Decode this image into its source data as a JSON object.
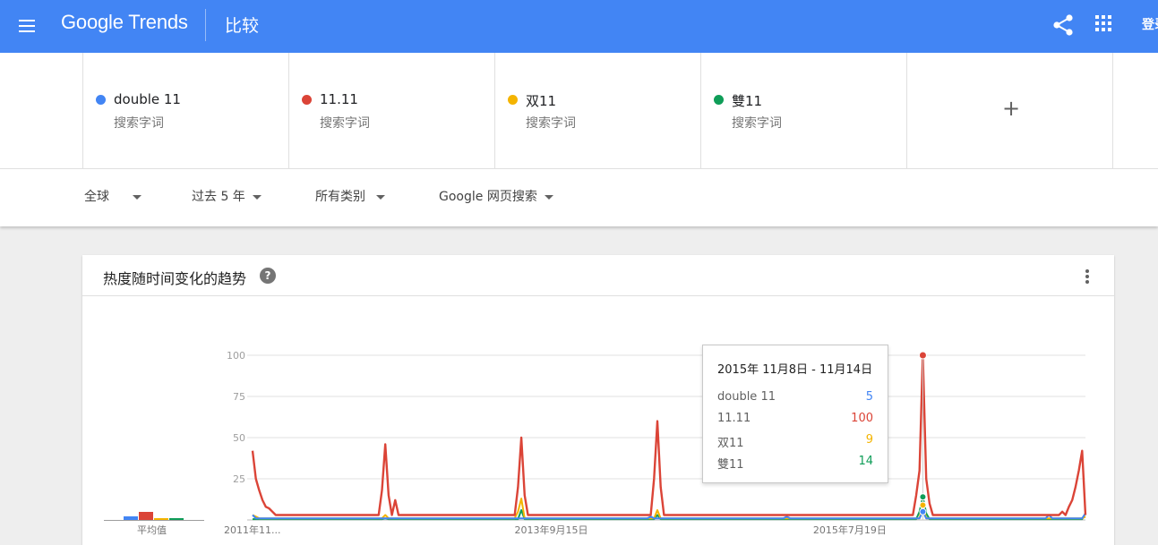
{
  "header": {
    "logo": "Google Trends",
    "title": "比较",
    "login": "登录"
  },
  "terms": [
    {
      "name": "double 11",
      "type": "搜索字词",
      "color": "#4285f4"
    },
    {
      "name": "11.11",
      "type": "搜索字词",
      "color": "#db4437"
    },
    {
      "name": "双11",
      "type": "搜索字词",
      "color": "#f4b400"
    },
    {
      "name": "雙11",
      "type": "搜索字词",
      "color": "#0f9d58"
    }
  ],
  "add_term": "+",
  "filters": {
    "region": "全球",
    "time": "过去 5 年",
    "category": "所有类别",
    "property": "Google 网页搜索"
  },
  "card": {
    "title": "热度随时间变化的趋势",
    "help": "?",
    "avg_label": "平均值"
  },
  "tooltip": {
    "date": "2015年 11月8日 - 11月14日",
    "rows": [
      {
        "label": "double 11",
        "value": "5",
        "color": "#4285f4"
      },
      {
        "label": "11.11",
        "value": "100",
        "color": "#db4437"
      },
      {
        "label": "双11",
        "value": "9",
        "color": "#f4b400"
      },
      {
        "label": "雙11",
        "value": "14",
        "color": "#0f9d58"
      }
    ]
  },
  "chart_data": {
    "type": "line",
    "y_ticks": [
      "100",
      "75",
      "50",
      "25"
    ],
    "ylim": [
      0,
      100
    ],
    "x_ticks": [
      "2011年11...",
      "2013年9月15日",
      "2015年7月19日"
    ],
    "grid": true,
    "averages": [
      {
        "name": "double 11",
        "value": 2
      },
      {
        "name": "11.11",
        "value": 5
      },
      {
        "name": "双11",
        "value": 1
      },
      {
        "name": "雙11",
        "value": 1
      }
    ],
    "highlight_index": 202,
    "series": [
      {
        "name": "double 11",
        "color": "#4285f4",
        "baseline": 1,
        "peaks": [
          [
            0,
            3
          ],
          [
            40,
            1
          ],
          [
            80,
            1
          ],
          [
            120,
            2
          ],
          [
            161,
            2
          ],
          [
            202,
            5
          ],
          [
            240,
            3
          ],
          [
            251,
            4
          ]
        ]
      },
      {
        "name": "11.11",
        "color": "#db4437",
        "baseline": 3,
        "peaks": [
          [
            0,
            42
          ],
          [
            1,
            25
          ],
          [
            2,
            18
          ],
          [
            3,
            12
          ],
          [
            4,
            8
          ],
          [
            5,
            7
          ],
          [
            6,
            5
          ],
          [
            39,
            18
          ],
          [
            40,
            46
          ],
          [
            41,
            15
          ],
          [
            43,
            12
          ],
          [
            80,
            20
          ],
          [
            81,
            50
          ],
          [
            82,
            15
          ],
          [
            121,
            25
          ],
          [
            122,
            60
          ],
          [
            123,
            20
          ],
          [
            200,
            15
          ],
          [
            201,
            30
          ],
          [
            202,
            100
          ],
          [
            203,
            25
          ],
          [
            204,
            10
          ],
          [
            244,
            5
          ],
          [
            246,
            8
          ],
          [
            247,
            12
          ],
          [
            248,
            20
          ],
          [
            249,
            30
          ],
          [
            250,
            42
          ]
        ]
      },
      {
        "name": "双11",
        "color": "#f4b400",
        "baseline": 1,
        "peaks": [
          [
            0,
            3
          ],
          [
            1,
            2
          ],
          [
            40,
            3
          ],
          [
            81,
            13
          ],
          [
            80,
            5
          ],
          [
            122,
            6
          ],
          [
            202,
            9
          ],
          [
            251,
            2
          ]
        ]
      },
      {
        "name": "雙11",
        "color": "#0f9d58",
        "baseline": 0.5,
        "peaks": [
          [
            40,
            1
          ],
          [
            81,
            6
          ],
          [
            122,
            3
          ],
          [
            201,
            5
          ],
          [
            202,
            14
          ],
          [
            203,
            4
          ],
          [
            251,
            4
          ]
        ]
      }
    ]
  }
}
